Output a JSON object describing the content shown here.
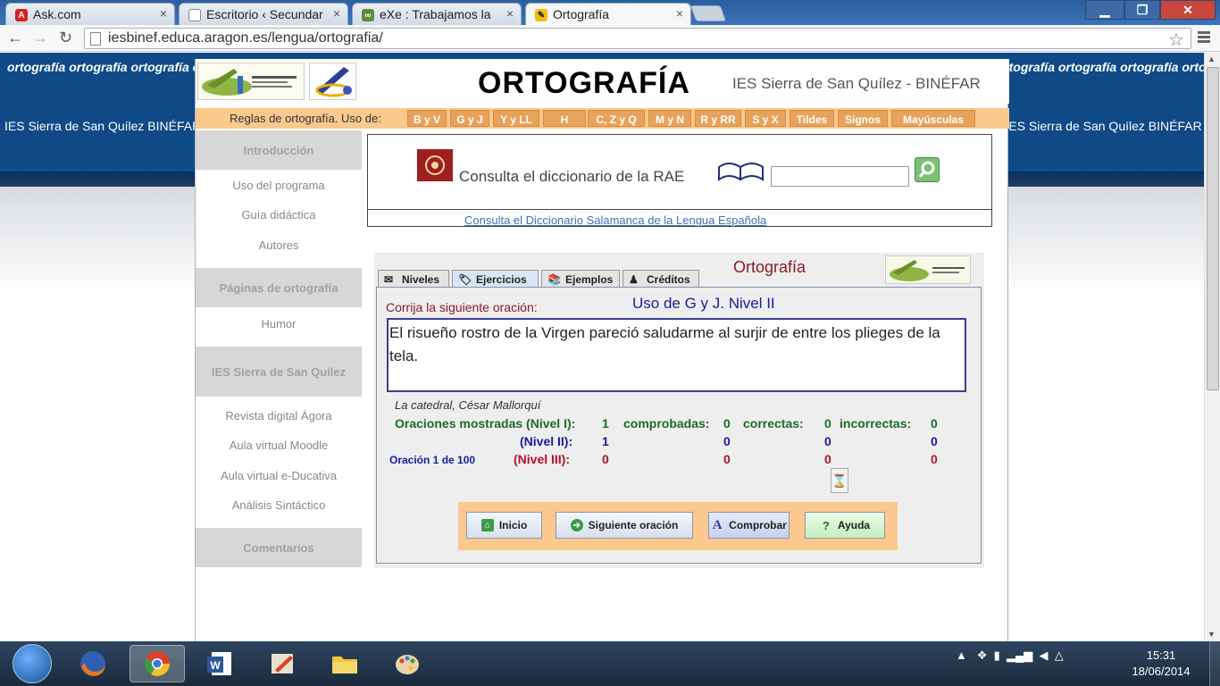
{
  "browser": {
    "tabs": [
      {
        "title": "Ask.com",
        "icon": "ask-icon"
      },
      {
        "title": "Escritorio ‹ Secundar",
        "icon": "page-icon"
      },
      {
        "title": "eXe : Trabajamos la",
        "icon": "exe-icon"
      },
      {
        "title": "Ortografía",
        "icon": "ortografia-icon"
      }
    ],
    "url": "iesbinef.educa.aragon.es/lengua/ortografia/"
  },
  "banner": {
    "scroll_text_1": "ortografía ortografía ortografía ortografía ortografía ortografía ortografía ortografía ortografía ortografía ortografía ortografía ortografía ortografía ortografía ortografía ortografía ortografía ortografía ortografía ortografía ortografía ortografía",
    "scroll_text_2": "IES Sierra de San Quílez BINÉFAR   IES Sierra de San Quílez BINÉFAR   IES Sierra de San Quílez BINÉFAR   IES Sierra de San Quílez BINÉFAR   IES Sierra de San Quílez BINÉFAR   IES Sierra de San Quílez BINÉFAR   IES Sierra de San Quílez BINÉFAR"
  },
  "header": {
    "title": "ORTOGRAFÍA",
    "school": "IES Sierra de San Quílez - BINÉFAR"
  },
  "rules": {
    "label": "Reglas de ortografía. Uso de:",
    "buttons": [
      "B y V",
      "G y J",
      "Y y LL",
      "H",
      "C, Z y Q",
      "M y N",
      "R y RR",
      "S y X",
      "Tildes",
      "Signos",
      "Mayúsculas"
    ]
  },
  "sidebar": {
    "head_intro": "Introducción",
    "links_intro": [
      "Uso del programa",
      "Guía didáctica",
      "Autores"
    ],
    "head_paginas": "Páginas de ortografía",
    "links_paginas": [
      "Humor"
    ],
    "head_ies": "IES Sierra de San Quílez",
    "links_ies": [
      "Revista digital Ágora",
      "Aula virtual Moodle",
      "Aula virtual e-Ducativa",
      "Análisis Sintáctico"
    ],
    "head_comentarios": "Comentarios"
  },
  "rae": {
    "text": "Consulta el diccionario de la RAE",
    "search_value": "",
    "salamanca_link": "Consulta el Diccionario Salamanca de la Lengua Española"
  },
  "exercise": {
    "tabs": [
      "Niveles",
      "Ejercicios",
      "Ejemplos",
      "Créditos"
    ],
    "active_tab": "Ejercicios",
    "title": "Ortografía",
    "prompt": "Corrija la siguiente oración:",
    "level_title": "Uso de G y J. Nivel II",
    "sentence": "El risueño rostro de la Virgen pareció saludarme al surjir de entre los plieges de la tela.",
    "source": "La catedral, César Mallorquí",
    "stats": {
      "label_mostradas": "Oraciones mostradas (Nivel I):",
      "label_comprobadas": "comprobadas:",
      "label_correctas": "correctas:",
      "label_incorrectas": "incorrectas:",
      "label_nivel2": "(Nivel II):",
      "label_nivel3": "(Nivel III):",
      "nivel1": {
        "mostradas": "1",
        "comprobadas": "0",
        "correctas": "0",
        "incorrectas": "0"
      },
      "nivel2": {
        "mostradas": "1",
        "comprobadas": "0",
        "correctas": "0",
        "incorrectas": "0"
      },
      "nivel3": {
        "mostradas": "0",
        "comprobadas": "0",
        "correctas": "0",
        "incorrectas": "0"
      }
    },
    "progress": "Oración 1 de  100",
    "buttons": {
      "inicio": "Inicio",
      "siguiente": "Siguiente oración",
      "comprobar": "Comprobar",
      "ayuda": "Ayuda"
    }
  },
  "taskbar": {
    "time": "15:31",
    "date": "18/06/2014"
  },
  "colors": {
    "banner": "#0f4a87",
    "orange": "#fbc88e",
    "rule_button": "#e7a25b",
    "green": "#1b6b2a",
    "blue": "#1a1aa0",
    "red": "#b51028"
  }
}
